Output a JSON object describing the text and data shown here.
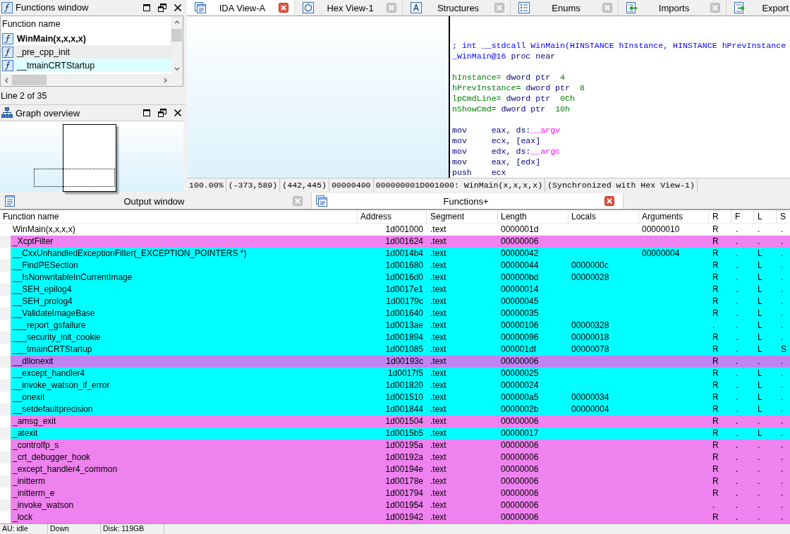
{
  "functions_window": {
    "title": "Functions window",
    "column": "Function name",
    "items": [
      {
        "name": "WinMain(x,x,x,x)",
        "bold": true,
        "selected": false
      },
      {
        "name": "_pre_cpp_init",
        "bold": false,
        "selected": true
      },
      {
        "name": "__tmainCRTStartup",
        "bold": false,
        "selected": false,
        "color": "#dcffff"
      }
    ],
    "status": "Line 2 of 35"
  },
  "graph_overview": {
    "title": "Graph overview"
  },
  "tabs": [
    {
      "label": "IDA View-A",
      "selected": true,
      "close_icon": true
    },
    {
      "label": "Hex View-1",
      "selected": false,
      "close_icon": true
    },
    {
      "label": "Structures",
      "selected": false,
      "close_icon": true
    },
    {
      "label": "Enums",
      "selected": false,
      "close_icon": true
    },
    {
      "label": "Imports",
      "selected": false,
      "close_icon": true
    },
    {
      "label": "Export",
      "selected": false,
      "close_icon": false
    }
  ],
  "disassembly": {
    "blocks": [
      [
        [
          {
            "text": "; int __stdcall WinMain(HINSTANCE hInstance, HINSTANCE hPrevInstance",
            "kind": "comment"
          }
        ],
        [
          {
            "text": "_WinMain@16",
            "kind": "name"
          },
          {
            "text": " proc near",
            "kind": "keyword"
          }
        ]
      ],
      [
        [
          {
            "text": "hInstance=",
            "kind": "variable"
          },
          {
            "text": " dword ptr  ",
            "kind": "keyword"
          },
          {
            "text": "4",
            "kind": "number"
          }
        ],
        [
          {
            "text": "hPrevInstance=",
            "kind": "variable"
          },
          {
            "text": " dword ptr  ",
            "kind": "keyword"
          },
          {
            "text": "8",
            "kind": "number"
          }
        ],
        [
          {
            "text": "lpCmdLine=",
            "kind": "variable"
          },
          {
            "text": " dword ptr  ",
            "kind": "keyword"
          },
          {
            "text": "0Ch",
            "kind": "number"
          }
        ],
        [
          {
            "text": "nShowCmd=",
            "kind": "variable"
          },
          {
            "text": " dword ptr  ",
            "kind": "keyword"
          },
          {
            "text": "10h",
            "kind": "number"
          }
        ]
      ],
      [
        [
          {
            "text": "mov     eax, ds:",
            "kind": "keyword"
          },
          {
            "text": "__argv",
            "kind": "import"
          }
        ],
        [
          {
            "text": "mov     ecx, [eax]",
            "kind": "keyword"
          }
        ],
        [
          {
            "text": "mov     edx, ds:",
            "kind": "keyword"
          },
          {
            "text": "__argc",
            "kind": "import"
          }
        ],
        [
          {
            "text": "mov     eax, [edx]",
            "kind": "keyword"
          }
        ],
        [
          {
            "text": "push    ecx",
            "kind": "keyword"
          }
        ]
      ]
    ]
  },
  "status_line": [
    "100.00%",
    "(-373,589)",
    "(442,445)",
    "00000400",
    "000000001D001000: WinMain(x,x,x,x)",
    "(Synchronized with Hex View-1)"
  ],
  "dock_tabs": [
    {
      "label": "Output window",
      "selected": false
    },
    {
      "label": "Functions+",
      "selected": true
    }
  ],
  "table": {
    "columns": [
      "Function name",
      "Address",
      "Segment",
      "Length",
      "Locals",
      "Arguments",
      "R",
      "F",
      "L",
      "S"
    ],
    "rows": [
      {
        "name": "WinMain(x,x,x,x)",
        "address": "1d001000",
        "segment": ".text",
        "length": "0000001d",
        "arguments": "00000010",
        "r": "R",
        "f": ".",
        "l": ".",
        "s": ".",
        "color": "#ffffff"
      },
      {
        "name": "_XcptFilter",
        "address": "1d001624",
        "segment": ".text",
        "length": "00000006",
        "r": "R",
        "f": ".",
        "l": ".",
        "s": ".",
        "color": "#ee82ee"
      },
      {
        "name": "__CxxUnhandledExceptionFilter(_EXCEPTION_POINTERS *)",
        "address": "1d0014b4",
        "segment": ".text",
        "length": "00000042",
        "arguments": "00000004",
        "r": "R",
        "f": ".",
        "l": "L",
        "s": ".",
        "color": "#00ffff"
      },
      {
        "name": "__FindPESection",
        "address": "1d001680",
        "segment": ".text",
        "length": "00000044",
        "locals": "0000000c",
        "r": "R",
        "f": ".",
        "l": "L",
        "s": ".",
        "color": "#00ffff"
      },
      {
        "name": "__IsNonwritableInCurrentImage",
        "address": "1d0016d0",
        "segment": ".text",
        "length": "000000bd",
        "locals": "00000028",
        "r": "R",
        "f": ".",
        "l": "L",
        "s": ".",
        "color": "#00ffff"
      },
      {
        "name": "__SEH_epilog4",
        "address": "1d0017e1",
        "segment": ".text",
        "length": "00000014",
        "r": "R",
        "f": ".",
        "l": "L",
        "s": ".",
        "color": "#00ffff"
      },
      {
        "name": "__SEH_prolog4",
        "address": "1d00179c",
        "segment": ".text",
        "length": "00000045",
        "r": "R",
        "f": ".",
        "l": "L",
        "s": ".",
        "color": "#00ffff"
      },
      {
        "name": "__ValidateImageBase",
        "address": "1d001640",
        "segment": ".text",
        "length": "00000035",
        "r": "R",
        "f": ".",
        "l": "L",
        "s": ".",
        "color": "#00ffff"
      },
      {
        "name": "___report_gsfailure",
        "address": "1d0013ae",
        "segment": ".text",
        "length": "00000106",
        "locals": "00000328",
        "r": ".",
        "f": ".",
        "l": "L",
        "s": ".",
        "color": "#00ffff"
      },
      {
        "name": "___security_init_cookie",
        "address": "1d001894",
        "segment": ".text",
        "length": "00000096",
        "locals": "00000018",
        "r": "R",
        "f": ".",
        "l": "L",
        "s": ".",
        "color": "#00ffff"
      },
      {
        "name": "___tmainCRTStartup",
        "address": "1d001085",
        "segment": ".text",
        "length": "000001df",
        "locals": "00000078",
        "r": "R",
        "f": ".",
        "l": "L",
        "s": "S",
        "color": "#00ffff"
      },
      {
        "name": "__dllonexit",
        "address": "1d00193c",
        "segment": ".text",
        "length": "00000006",
        "r": "R",
        "f": ".",
        "l": ".",
        "s": ".",
        "color": "#c084f2"
      },
      {
        "name": "__except_handler4",
        "address": "1d0017f5",
        "segment": ".text",
        "length": "00000025",
        "r": "R",
        "f": ".",
        "l": "L",
        "s": ".",
        "color": "#00ffff"
      },
      {
        "name": "__invoke_watson_if_error",
        "address": "1d001820",
        "segment": ".text",
        "length": "00000024",
        "r": "R",
        "f": ".",
        "l": "L",
        "s": ".",
        "color": "#00ffff"
      },
      {
        "name": "__onexit",
        "address": "1d001510",
        "segment": ".text",
        "length": "000000a5",
        "locals": "00000034",
        "r": "R",
        "f": ".",
        "l": "L",
        "s": ".",
        "color": "#00ffff"
      },
      {
        "name": "__setdefaultprecision",
        "address": "1d001844",
        "segment": ".text",
        "length": "0000002b",
        "locals": "00000004",
        "r": "R",
        "f": ".",
        "l": "L",
        "s": ".",
        "color": "#00ffff"
      },
      {
        "name": "_amsg_exit",
        "address": "1d001504",
        "segment": ".text",
        "length": "00000006",
        "r": "R",
        "f": ".",
        "l": ".",
        "s": ".",
        "color": "#ee82ee"
      },
      {
        "name": "_atexit",
        "address": "1d0015b5",
        "segment": ".text",
        "length": "00000017",
        "r": "R",
        "f": ".",
        "l": "L",
        "s": ".",
        "color": "#00ffff"
      },
      {
        "name": "_controlfp_s",
        "address": "1d00195a",
        "segment": ".text",
        "length": "00000006",
        "r": "R",
        "f": ".",
        "l": ".",
        "s": ".",
        "color": "#ee82ee"
      },
      {
        "name": "_crt_debugger_hook",
        "address": "1d00192a",
        "segment": ".text",
        "length": "00000006",
        "r": "R",
        "f": ".",
        "l": ".",
        "s": ".",
        "color": "#ee82ee"
      },
      {
        "name": "_except_handler4_common",
        "address": "1d00194e",
        "segment": ".text",
        "length": "00000006",
        "r": "R",
        "f": ".",
        "l": ".",
        "s": ".",
        "color": "#ee82ee"
      },
      {
        "name": "_initterm",
        "address": "1d00178e",
        "segment": ".text",
        "length": "00000006",
        "r": "R",
        "f": ".",
        "l": ".",
        "s": ".",
        "color": "#ee82ee"
      },
      {
        "name": "_initterm_e",
        "address": "1d001794",
        "segment": ".text",
        "length": "00000006",
        "r": "R",
        "f": ".",
        "l": ".",
        "s": ".",
        "color": "#ee82ee"
      },
      {
        "name": "_invoke_watson",
        "address": "1d001954",
        "segment": ".text",
        "length": "00000006",
        "r": ".",
        "f": ".",
        "l": ".",
        "s": ".",
        "color": "#ee82ee"
      },
      {
        "name": "_lock",
        "address": "1d001942",
        "segment": ".text",
        "length": "00000006",
        "r": "R",
        "f": ".",
        "l": ".",
        "s": ".",
        "color": "#ee82ee"
      }
    ]
  },
  "status_bar": [
    "AU: idle",
    "Down",
    "Disk: 119GB"
  ]
}
